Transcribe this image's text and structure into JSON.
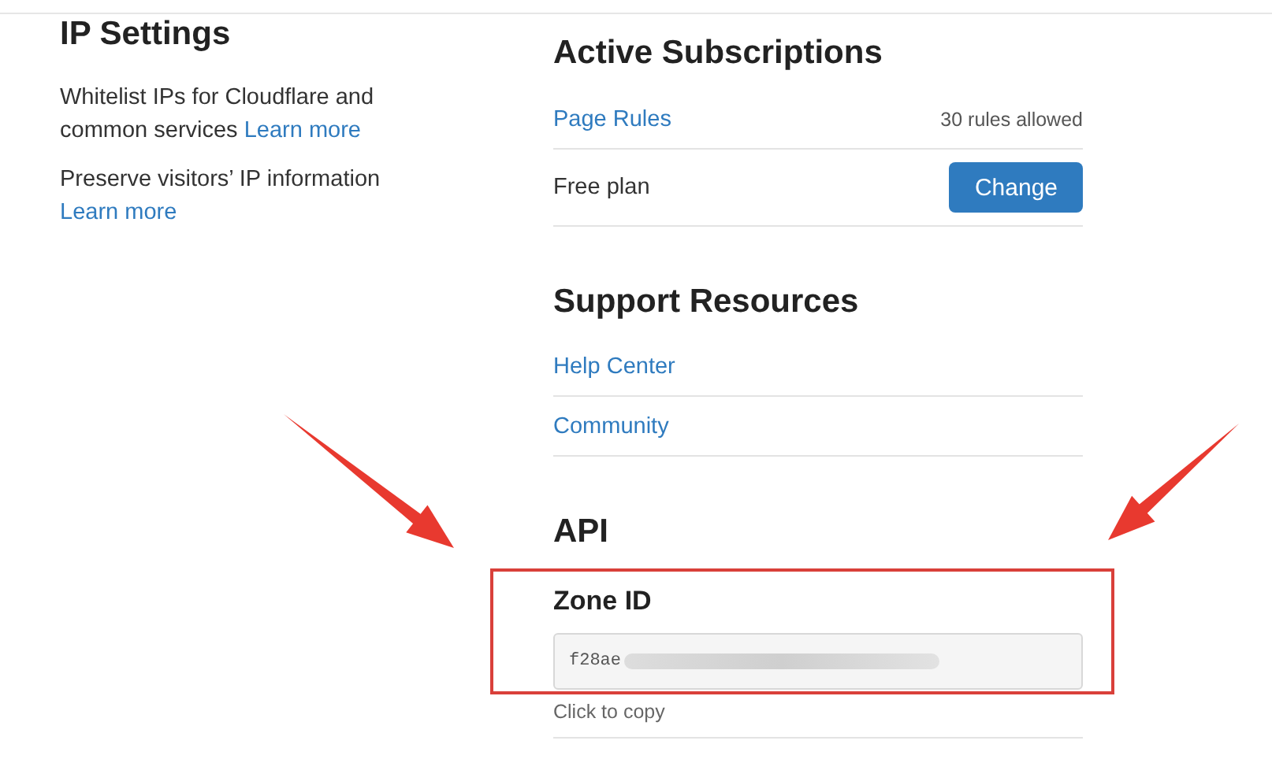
{
  "ip_settings": {
    "title": "IP Settings",
    "items": [
      {
        "text": "Whitelist IPs for Cloudflare and common services",
        "link": "Learn more"
      },
      {
        "text": "Preserve visitors’ IP information",
        "link": "Learn more"
      }
    ]
  },
  "active_subscriptions": {
    "title": "Active Subscriptions",
    "rows": [
      {
        "kind": "link",
        "label": "Page Rules",
        "note": "30 rules allowed"
      },
      {
        "kind": "button",
        "label": "Free plan",
        "button": "Change"
      }
    ]
  },
  "support_resources": {
    "title": "Support Resources",
    "links": [
      "Help Center",
      "Community"
    ]
  },
  "api": {
    "title": "API",
    "zone_id": {
      "label": "Zone ID",
      "value": "f28ae",
      "hint": "Click to copy"
    }
  }
}
